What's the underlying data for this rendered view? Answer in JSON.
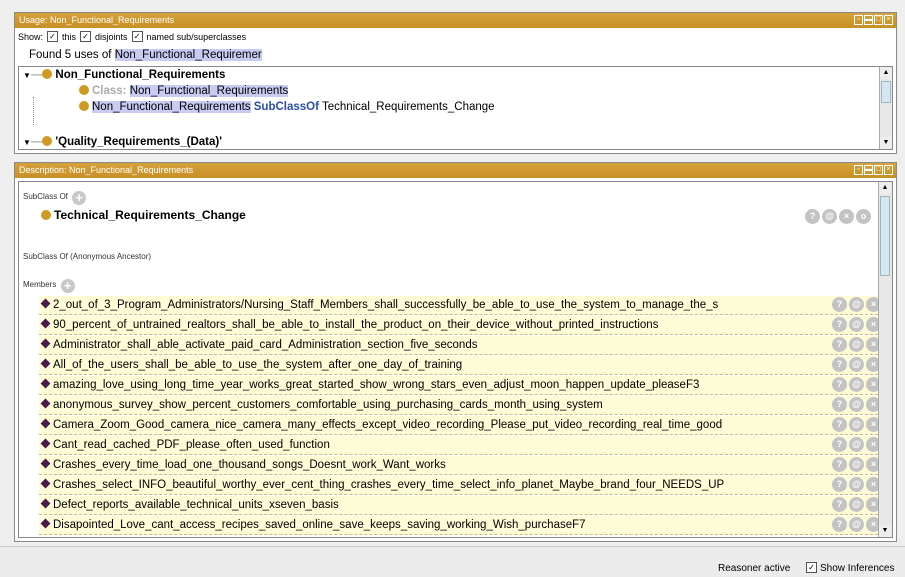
{
  "usage": {
    "title": "Usage: Non_Functional_Requirements",
    "show_label": "Show:",
    "checks": [
      {
        "label": "this",
        "checked": true
      },
      {
        "label": "disjoints",
        "checked": true
      },
      {
        "label": "named sub/superclasses",
        "checked": true
      }
    ],
    "found_prefix": "Found 5 uses of",
    "found_term": "Non_Functional_Requiremer",
    "tree": {
      "node1": "Non_Functional_Requirements",
      "child1_prefix": "Class:",
      "child1_name": "Non_Functional_Requirements",
      "child2_name": "Non_Functional_Requirements",
      "child2_keyword": "SubClassOf",
      "child2_target": "Technical_Requirements_Change",
      "node2": "'Quality_Requirements_(Data)'"
    }
  },
  "description": {
    "title": "Description: Non_Functional_Requirements",
    "subclass_label": "SubClass Of",
    "subclass_item": "Technical_Requirements_Change",
    "anon_label": "SubClass Of (Anonymous Ancestor)",
    "members_label": "Members",
    "members": [
      "2_out_of_3_Program_Administrators/Nursing_Staff_Members_shall_successfully_be_able_to_use_the_system_to_manage_the_s",
      "90_percent_of_untrained_realtors_shall_be_able_to_install_the_product_on_their_device_without_printed_instructions",
      "Administrator_shall_able_activate_paid_card_Administration_section_five_seconds",
      "All_of_the_users_shall_be_able_to_use_the_system_after_one_day_of_training",
      "amazing_love_using_long_time_year_works_great_started_show_wrong_stars_even_adjust_moon_happen_update_pleaseF3",
      "anonymous_survey_show_percent_customers_comfortable_using_purchasing_cards_month_using_system",
      "Camera_Zoom_Good_camera_nice_camera_many_effects_except_video_recording_Please_put_video_recording_real_time_good",
      "Cant_read_cached_PDF_please_often_used_function",
      "Crashes_every_time_load_one_thousand_songs_Doesnt_work_Want_works",
      "Crashes_select_INFO_beautiful_worthy_ever_cent_thing_crashes_every_time_select_info_planet_Maybe_brand_four_NEEDS_UP",
      "Defect_reports_available_technical_units_xseven_basis",
      "Disapointed_Love_cant_access_recipes_saved_online_save_keeps_saving_working_Wish_purchaseF7"
    ]
  },
  "status": {
    "reasoner": "Reasoner active",
    "show_inferences": "Show Inferences"
  },
  "row_buttons": [
    "?",
    "@",
    "×",
    "o"
  ]
}
